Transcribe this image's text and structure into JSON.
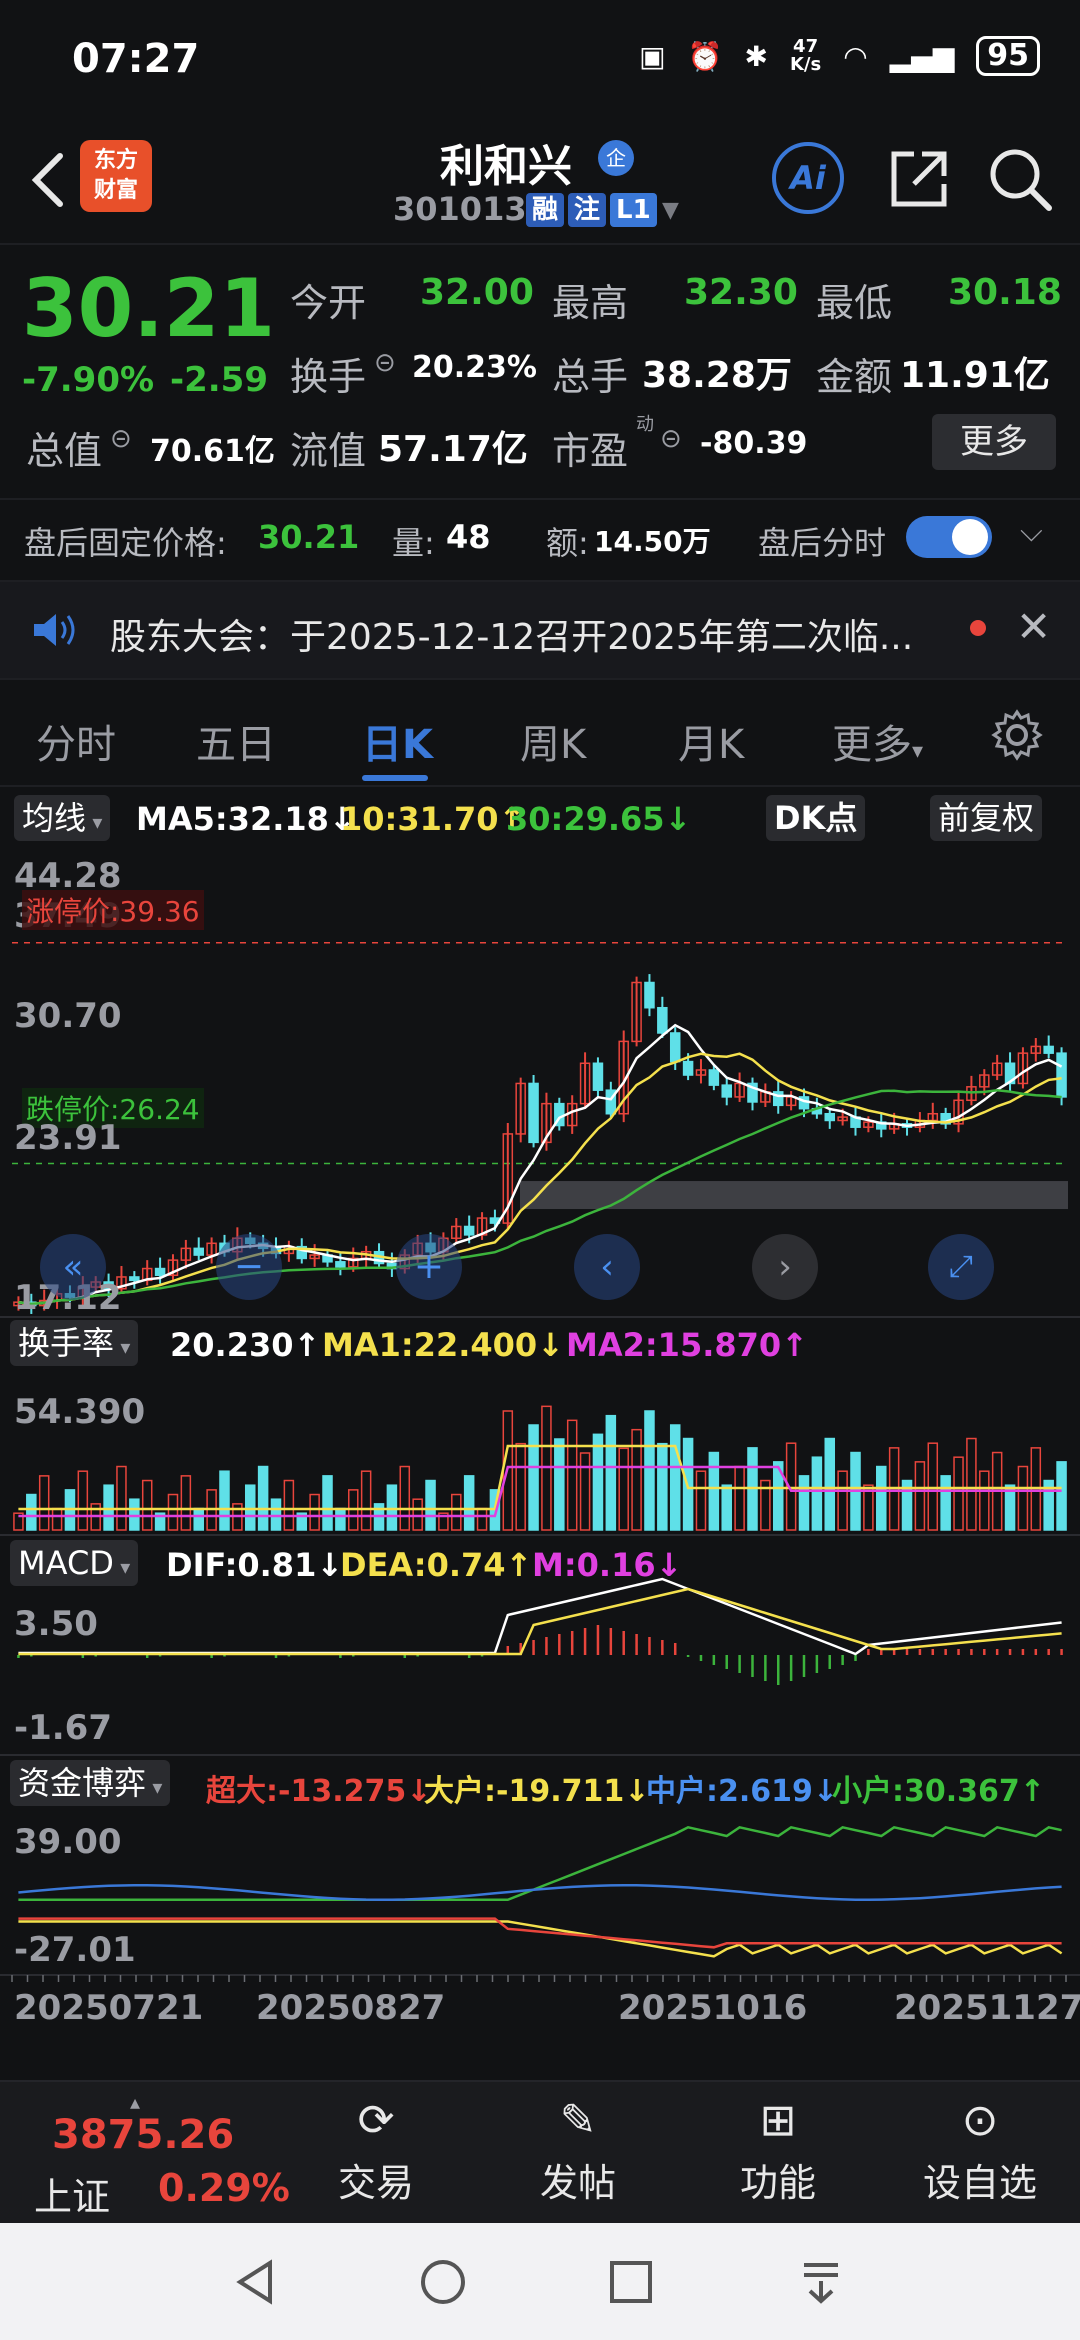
{
  "status": {
    "time": "07:27",
    "net_speed_top": "47",
    "net_speed_unit": "K/s",
    "battery": "95"
  },
  "header": {
    "logo_line1": "东方",
    "logo_line2": "财富",
    "name": "利和兴",
    "name_badge": "企",
    "code": "301013",
    "tags": [
      "融",
      "注",
      "L1"
    ],
    "ai_label": "Ai"
  },
  "quote": {
    "price": "30.21",
    "chg_pct": "-7.90%",
    "chg_amt": "-2.59",
    "open_label": "今开",
    "open": "32.00",
    "high_label": "最高",
    "high": "32.30",
    "low_label": "最低",
    "low": "30.18",
    "turnover_label": "换手",
    "turnover": "20.23%",
    "volume_label": "总手",
    "volume": "38.28万",
    "amount_label": "金额",
    "amount": "11.91亿",
    "mktcap_label": "总值",
    "mktcap": "70.61亿",
    "float_label": "流值",
    "float": "57.17亿",
    "pe_label": "市盈",
    "pe_sup": "动",
    "pe": "-80.39",
    "more": "更多"
  },
  "afterhours": {
    "price_label": "盘后固定价格:",
    "price": "30.21",
    "vol_label": "量:",
    "vol": "48",
    "amt_label": "额:",
    "amt": "14.50万",
    "timeshare_label": "盘后分时"
  },
  "notice": {
    "text": "股东大会：于2025-12-12召开2025年第二次临..."
  },
  "tabs": [
    "分时",
    "五日",
    "日K",
    "周K",
    "月K",
    "更多"
  ],
  "kline": {
    "ma_label": "均线",
    "ma5": "MA5:32.18↓",
    "ma10": "10:31.70↑",
    "ma30": "30:29.65↓",
    "dk_label": "DK点",
    "adj_label": "前复权",
    "y_ticks": [
      "44.28",
      "37.49",
      "30.70",
      "23.91",
      "17.12"
    ],
    "limit_up": "涨停价:39.36",
    "limit_down": "跌停价:26.24"
  },
  "turnover_panel": {
    "label": "换手率",
    "val": "20.230↑",
    "ma1": "MA1:22.400↓",
    "ma2": "MA2:15.870↑",
    "y_top": "54.390"
  },
  "macd_panel": {
    "label": "MACD",
    "dif": "DIF:0.81↓",
    "dea": "DEA:0.74↑",
    "m": "M:0.16↓",
    "y_top": "3.50",
    "y_bottom": "-1.67"
  },
  "fund_panel": {
    "label": "资金博弈",
    "super": "超大:-13.275↓",
    "big": "大户:-19.711↓",
    "mid": "中户:2.619↓",
    "small": "小户:30.367↑",
    "y_top": "39.00",
    "y_bottom": "-27.01"
  },
  "x_dates": [
    "20250721",
    "20250827",
    "20251016",
    "20251127"
  ],
  "bottom_nav": {
    "index_val": "3875.26",
    "index_name": "上证",
    "index_pct": "0.29%",
    "items": [
      "交易",
      "发帖",
      "功能",
      "设自选"
    ]
  },
  "colors": {
    "up": "#e8453c",
    "down": "#5fe0e8",
    "ma5": "#ffffff",
    "ma10": "#f4e04d",
    "ma30": "#3cb43c",
    "accent": "#3a78d8"
  },
  "chart_data": {
    "type": "candlestick",
    "ylim": [
      17.12,
      44.28
    ],
    "closes": [
      18.0,
      17.8,
      18.1,
      18.5,
      18.3,
      18.9,
      19.2,
      18.8,
      19.5,
      19.3,
      20.0,
      19.6,
      20.5,
      21.2,
      20.8,
      21.5,
      21.0,
      21.8,
      21.5,
      21.2,
      20.9,
      21.3,
      20.6,
      20.8,
      20.4,
      20.1,
      20.6,
      21.0,
      20.3,
      20.0,
      20.8,
      21.5,
      21.0,
      21.8,
      22.5,
      22.0,
      23.0,
      22.7,
      28.0,
      31.0,
      27.5,
      29.8,
      28.5,
      29.8,
      32.2,
      30.6,
      29.2,
      33.5,
      37.0,
      35.5,
      34.0,
      32.3,
      31.5,
      31.8,
      30.9,
      30.2,
      31.0,
      29.9,
      30.5,
      29.7,
      30.2,
      29.5,
      29.2,
      28.8,
      29.0,
      28.4,
      28.7,
      28.3,
      28.6,
      28.4,
      28.8,
      29.2,
      28.6,
      30.0,
      30.8,
      31.5,
      32.2,
      31.0,
      32.8,
      33.2,
      32.8,
      30.2
    ]
  }
}
